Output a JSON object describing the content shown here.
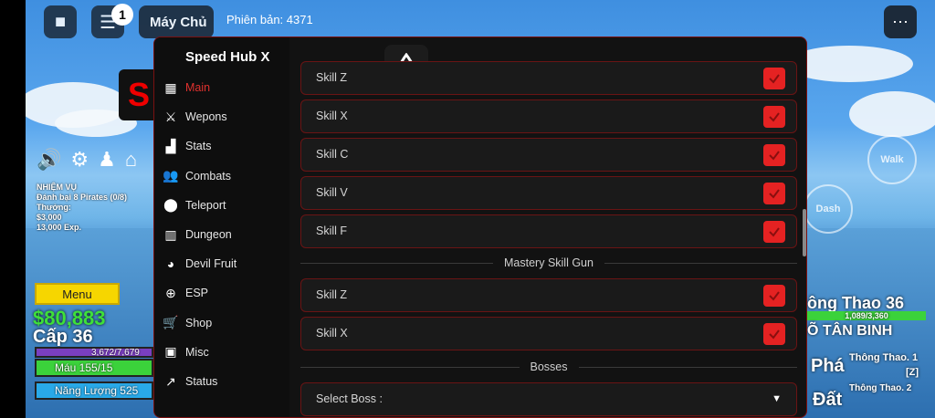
{
  "topbar": {
    "notification_count": "1",
    "server_button": "Máy Chủ",
    "version": "Phiên bản: 4371"
  },
  "game_hud": {
    "quest_title": "NHIỆM VỤ",
    "quest_text": "Đánh bại 8 Pirates (0/8)",
    "reward_label": "Thưởng:",
    "reward_money": "$3,000",
    "reward_exp": "13,000 Exp.",
    "menu_button": "Menu",
    "money": "$80,883",
    "level": "Cấp 36",
    "exp_bar": "3,672/7,679",
    "health_bar": "Máu 155/15",
    "energy_bar": "Năng Lượng 525",
    "right_title": "ông Thao 36",
    "right_bar": "1,089/3,360",
    "right_rank": "Õ TÂN BINH",
    "right_skill": "Thông Thao. 1",
    "right_key": "[Z]",
    "right_skill2": "Thông Thao. 2",
    "right_pha": "Phá",
    "right_dat": "Đất",
    "walk_label": "Walk",
    "dash_label": "Dash"
  },
  "hub": {
    "title": "Speed Hub X",
    "nav": [
      {
        "label": "Main",
        "icon": "home-icon",
        "active": true
      },
      {
        "label": "Wepons",
        "icon": "sword-icon",
        "active": false
      },
      {
        "label": "Stats",
        "icon": "signal-icon",
        "active": false
      },
      {
        "label": "Combats",
        "icon": "users-icon",
        "active": false
      },
      {
        "label": "Teleport",
        "icon": "pin-icon",
        "active": false
      },
      {
        "label": "Dungeon",
        "icon": "building-icon",
        "active": false
      },
      {
        "label": "Devil Fruit",
        "icon": "fruit-icon",
        "active": false
      },
      {
        "label": "ESP",
        "icon": "crosshair-icon",
        "active": false
      },
      {
        "label": "Shop",
        "icon": "cart-icon",
        "active": false
      },
      {
        "label": "Misc",
        "icon": "grid-icon",
        "active": false
      },
      {
        "label": "Status",
        "icon": "chart-icon",
        "active": false
      }
    ],
    "skill_rows": [
      "Skill Z",
      "Skill X",
      "Skill C",
      "Skill V",
      "Skill F"
    ],
    "gun_section": "Mastery Skill Gun",
    "gun_rows": [
      "Skill Z",
      "Skill X"
    ],
    "boss_section": "Bosses",
    "boss_select": "Select Boss :",
    "accent_color": "#e52222"
  }
}
